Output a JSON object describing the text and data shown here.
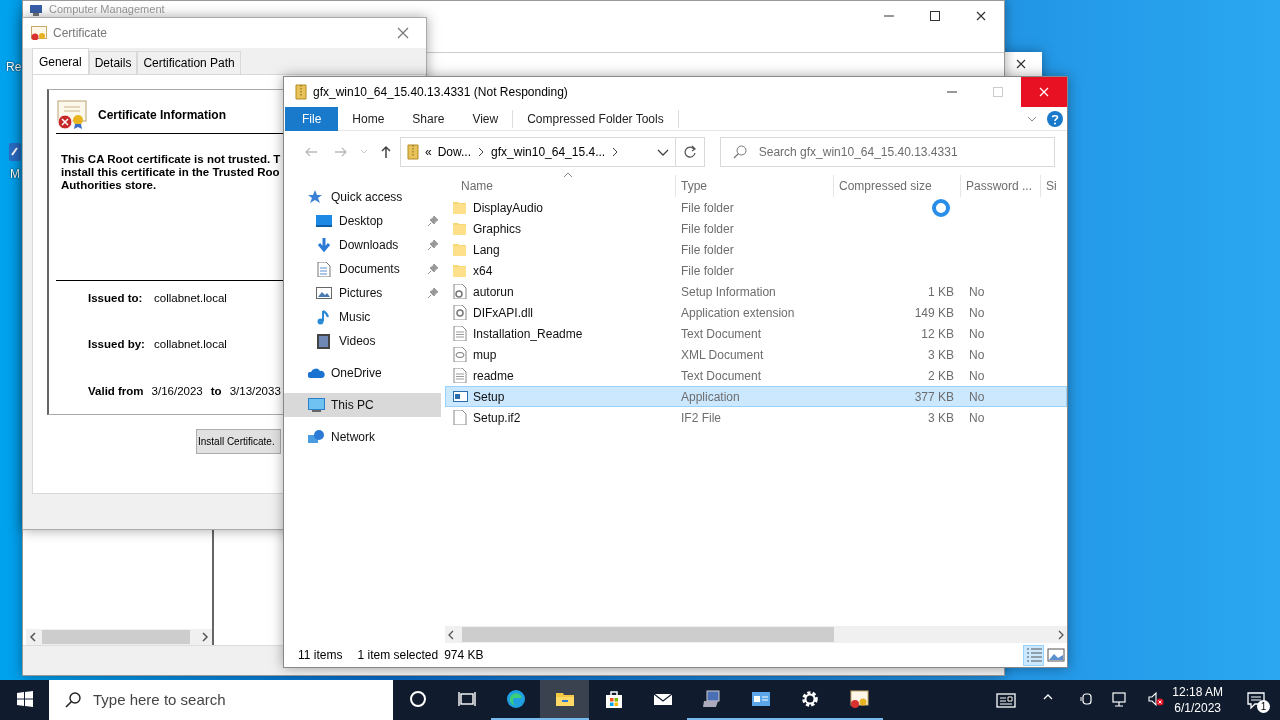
{
  "desktop_icons": [
    {
      "label": "Re"
    },
    {
      "label": "M"
    }
  ],
  "background_window": {
    "title": "Computer Management"
  },
  "certificate": {
    "title": "Certificate",
    "tabs": [
      {
        "label": "General",
        "selected": true
      },
      {
        "label": "Details",
        "selected": false
      },
      {
        "label": "Certification Path",
        "selected": false
      }
    ],
    "heading": "Certificate Information",
    "message": "This CA Root certificate is not trusted. T\ninstall this certificate in the Trusted Roo\nAuthorities store.",
    "fields": [
      {
        "label": "Issued to:",
        "value": "collabnet.local"
      },
      {
        "label": "Issued by:",
        "value": "collabnet.local"
      }
    ],
    "validity": {
      "from_label": "Valid from",
      "from": "3/16/2023",
      "to_label": "to",
      "to": "3/13/2033"
    },
    "button": "Install Certificate."
  },
  "explorer": {
    "title": "gfx_win10_64_15.40.13.4331 (Not Responding)",
    "ribbon_tabs": [
      {
        "label": "File",
        "selected": true
      },
      {
        "label": "Home",
        "selected": false
      },
      {
        "label": "Share",
        "selected": false
      },
      {
        "label": "View",
        "selected": false
      },
      {
        "label": "Compressed Folder Tools",
        "selected": false
      }
    ],
    "address": {
      "overflow": "«",
      "crumbs": [
        "Dow...",
        "gfx_win10_64_15.4..."
      ]
    },
    "search": {
      "placeholder": "Search gfx_win10_64_15.40.13.4331"
    },
    "nav": [
      {
        "label": "Quick access",
        "kind": "star",
        "selected": false,
        "children": [
          {
            "label": "Desktop",
            "kind": "desktop",
            "selected": false,
            "pinned": true
          },
          {
            "label": "Downloads",
            "kind": "download",
            "selected": false,
            "pinned": true
          },
          {
            "label": "Documents",
            "kind": "document",
            "selected": false,
            "pinned": true
          },
          {
            "label": "Pictures",
            "kind": "picture",
            "selected": false,
            "pinned": true
          },
          {
            "label": "Music",
            "kind": "music",
            "selected": false,
            "pinned": false
          },
          {
            "label": "Videos",
            "kind": "video",
            "selected": false,
            "pinned": false
          }
        ]
      },
      {
        "label": "OneDrive",
        "kind": "cloud",
        "selected": false
      },
      {
        "label": "This PC",
        "kind": "pc",
        "selected": true
      },
      {
        "label": "Network",
        "kind": "network",
        "selected": false
      }
    ],
    "columns": [
      "Name",
      "Type",
      "Compressed size",
      "Password ...",
      "Si"
    ],
    "rows": [
      {
        "name": "DisplayAudio",
        "kind": "folder",
        "type": "File folder",
        "selected": false
      },
      {
        "name": "Graphics",
        "kind": "folder",
        "type": "File folder",
        "selected": false
      },
      {
        "name": "Lang",
        "kind": "folder",
        "type": "File folder",
        "selected": false
      },
      {
        "name": "x64",
        "kind": "folder",
        "type": "File folder",
        "selected": false
      },
      {
        "name": "autorun",
        "kind": "setup",
        "type": "Setup Information",
        "size": "1 KB",
        "password": "No",
        "selected": false
      },
      {
        "name": "DIFxAPI.dll",
        "kind": "dll",
        "type": "Application extension",
        "size": "149 KB",
        "password": "No",
        "selected": false
      },
      {
        "name": "Installation_Readme",
        "kind": "text",
        "type": "Text Document",
        "size": "12 KB",
        "password": "No",
        "selected": false
      },
      {
        "name": "mup",
        "kind": "xml",
        "type": "XML Document",
        "size": "3 KB",
        "password": "No",
        "selected": false
      },
      {
        "name": "readme",
        "kind": "text",
        "type": "Text Document",
        "size": "2 KB",
        "password": "No",
        "selected": false
      },
      {
        "name": "Setup",
        "kind": "app",
        "type": "Application",
        "size": "377 KB",
        "password": "No",
        "selected": true
      },
      {
        "name": "Setup.if2",
        "kind": "file",
        "type": "IF2 File",
        "size": "3 KB",
        "password": "No",
        "selected": false
      }
    ],
    "status": {
      "count": "11 items",
      "selection": "1 item selected",
      "size": "974 KB"
    },
    "view_buttons": [
      {
        "kind": "details",
        "selected": true
      },
      {
        "kind": "tiles",
        "selected": false
      }
    ]
  },
  "taskbar": {
    "search_placeholder": "Type here to search",
    "apps": [
      {
        "kind": "cortana",
        "running": false,
        "active": false
      },
      {
        "kind": "taskview",
        "running": false,
        "active": false
      },
      {
        "kind": "edge",
        "running": true,
        "active": false
      },
      {
        "kind": "explorer",
        "running": true,
        "active": true
      },
      {
        "kind": "store",
        "running": false,
        "active": false
      },
      {
        "kind": "mail",
        "running": false,
        "active": false
      },
      {
        "kind": "server",
        "running": true,
        "active": false
      },
      {
        "kind": "console",
        "running": true,
        "active": false
      },
      {
        "kind": "settings",
        "running": true,
        "active": false
      },
      {
        "kind": "certificate",
        "running": true,
        "active": false
      }
    ],
    "clock": {
      "time": "12:18 AM",
      "date": "6/1/2023"
    },
    "notifications": "1"
  }
}
